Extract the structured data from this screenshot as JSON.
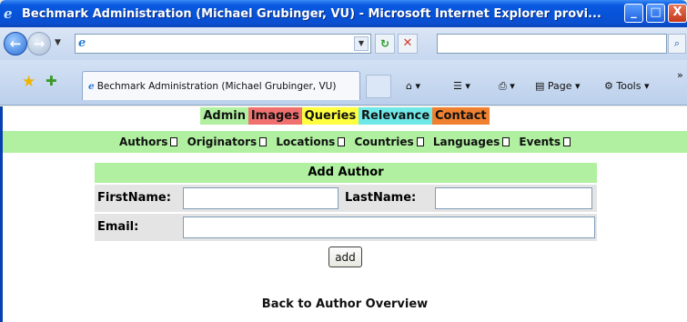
{
  "window": {
    "title": "Bechmark Administration (Michael Grubinger, VU) - Microsoft Internet Explorer provi...",
    "minimize_label": "_",
    "maximize_label": "□",
    "close_label": "X"
  },
  "addressbar": {
    "url": "",
    "search_value": ""
  },
  "tabs": {
    "active_title": "Bechmark Administration (Michael Grubinger, VU)"
  },
  "commandbar": {
    "page_label": "Page",
    "tools_label": "Tools",
    "more_label": "»"
  },
  "menu": {
    "items": [
      {
        "label": "Admin",
        "color": "#b0f0a0"
      },
      {
        "label": "Images",
        "color": "#f07070"
      },
      {
        "label": "Queries",
        "color": "#ffff40"
      },
      {
        "label": "Relevance",
        "color": "#70e8e8"
      },
      {
        "label": "Contact",
        "color": "#f08030"
      }
    ]
  },
  "submenu": {
    "items": [
      "Authors",
      "Originators",
      "Locations",
      "Countries",
      "Languages",
      "Events"
    ]
  },
  "form": {
    "header": "Add Author",
    "firstname_label": "FirstName:",
    "lastname_label": "LastName:",
    "email_label": "Email:",
    "firstname_value": "",
    "lastname_value": "",
    "email_value": "",
    "submit_label": "add"
  },
  "footer": {
    "back_link": "Back to Author Overview"
  }
}
